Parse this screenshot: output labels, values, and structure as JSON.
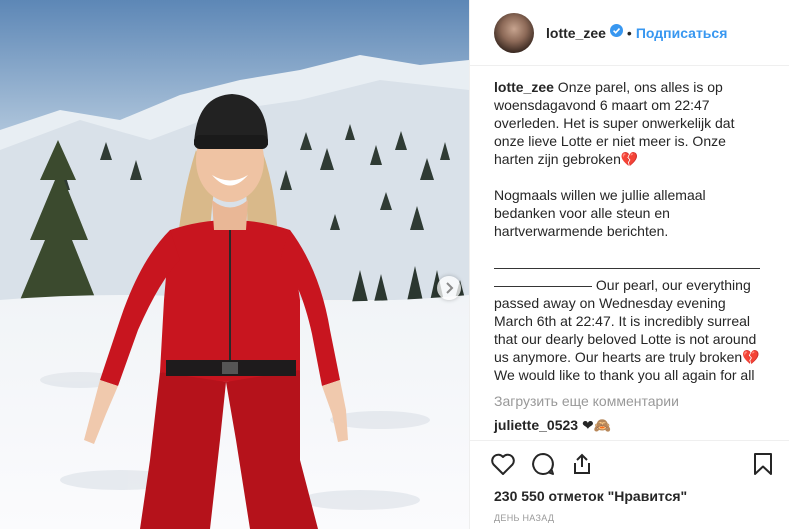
{
  "header": {
    "username": "lotte_zee",
    "separator": "•",
    "follow_label": "Подписаться"
  },
  "caption": {
    "username": "lotte_zee",
    "text": " Onze parel, ons alles is op woensdagavond 6 maart om 22:47 overleden. Het is super onwerkelijk dat onze lieve Lotte er niet meer is. Onze harten zijn gebroken💔\n\nNogmaals willen we jullie allemaal bedanken voor alle steun en hartverwarmende berichten.\n\n———————————————————\n——————— Our pearl, our everything passed away on Wednesday evening March 6th at 22:47. It is incredibly surreal that our dearly beloved Lotte is not around us anymore. Our hearts are truly broken💔\nWe would like to thank you all again for all the support and heartwarming messages."
  },
  "load_more_label": "Загрузить еще комментарии",
  "comment": {
    "username": "juliette_0523",
    "text": " ❤🙈"
  },
  "likes_label": "230 550 отметок \"Нравится\"",
  "time_label": "ДЕНЬ НАЗАД",
  "icons": {
    "like": "heart-icon",
    "comment": "comment-icon",
    "share": "share-icon",
    "save": "bookmark-icon",
    "verified": "verified-badge-icon",
    "next": "chevron-right-icon"
  },
  "colors": {
    "link_blue": "#3897f0",
    "suit_red": "#c8151f",
    "muted_text": "#999999"
  }
}
